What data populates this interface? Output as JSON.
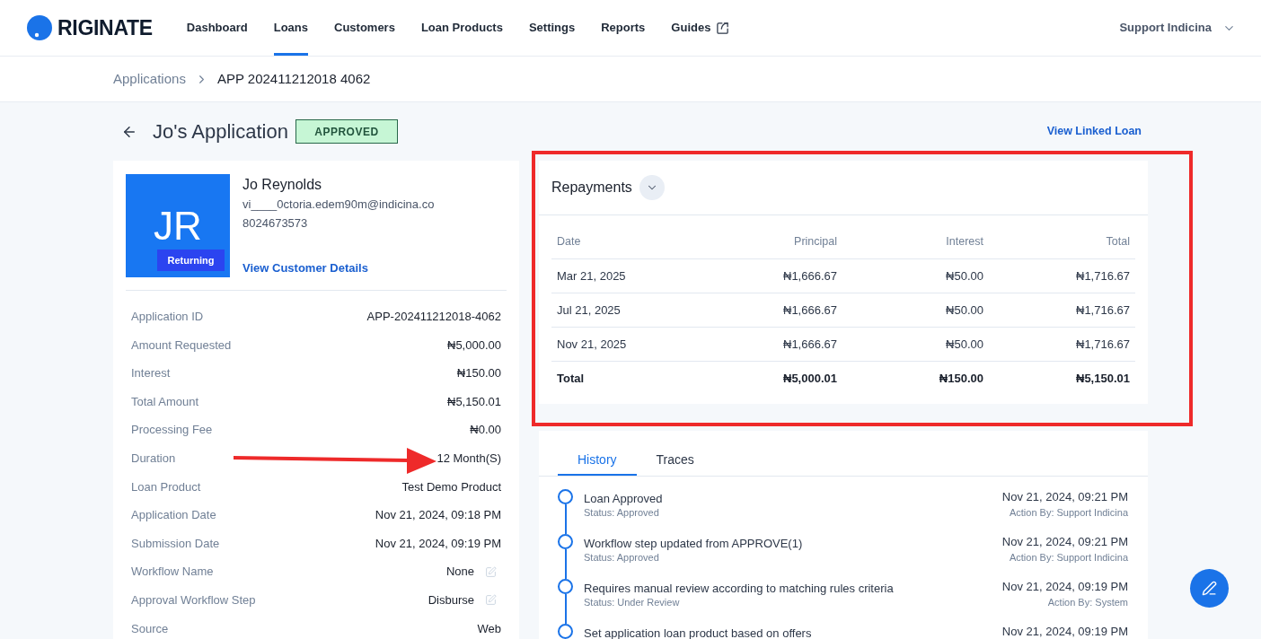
{
  "header": {
    "brand": "RIGINATE",
    "nav": [
      {
        "label": "Dashboard",
        "selected": false,
        "external": false
      },
      {
        "label": "Loans",
        "selected": true,
        "external": false
      },
      {
        "label": "Customers",
        "selected": false,
        "external": false
      },
      {
        "label": "Loan Products",
        "selected": false,
        "external": false
      },
      {
        "label": "Settings",
        "selected": false,
        "external": false
      },
      {
        "label": "Reports",
        "selected": false,
        "external": false
      },
      {
        "label": "Guides",
        "selected": false,
        "external": true
      }
    ],
    "user_menu": "Support Indicina"
  },
  "breadcrumb": [
    {
      "label": "Applications",
      "current": false
    },
    {
      "label": "APP 202411212018 4062",
      "current": true
    }
  ],
  "application": {
    "title": "Jo's Application",
    "status": "APPROVED",
    "linked_loan_link": "View Linked Loan"
  },
  "customer": {
    "initials": "JR",
    "tag": "Returning",
    "name": "Jo Reynolds",
    "email": "vi____0ctoria.edem90m@indicina.co",
    "phone": "8024673573",
    "details_link": "View Customer Details"
  },
  "details": [
    {
      "label": "Application ID",
      "value": "APP-202411212018-4062",
      "editable": false
    },
    {
      "label": "Amount Requested",
      "value": "₦5,000.00",
      "editable": false
    },
    {
      "label": "Interest",
      "value": "₦150.00",
      "editable": false
    },
    {
      "label": "Total Amount",
      "value": "₦5,150.01",
      "editable": false
    },
    {
      "label": "Processing Fee",
      "value": "₦0.00",
      "editable": false
    },
    {
      "label": "Duration",
      "value": "12 Month(S)",
      "editable": false
    },
    {
      "label": "Loan Product",
      "value": "Test Demo Product",
      "editable": false
    },
    {
      "label": "Application Date",
      "value": "Nov 21, 2024, 09:18 PM",
      "editable": false
    },
    {
      "label": "Submission Date",
      "value": "Nov 21, 2024, 09:19 PM",
      "editable": false
    },
    {
      "label": "Workflow Name",
      "value": "None",
      "editable": true
    },
    {
      "label": "Approval Workflow Step",
      "value": "Disburse",
      "editable": true
    },
    {
      "label": "Source",
      "value": "Web",
      "editable": false
    }
  ],
  "repayments": {
    "title": "Repayments",
    "columns": [
      "Date",
      "Principal",
      "Interest",
      "Total"
    ],
    "rows": [
      [
        "Mar 21, 2025",
        "₦1,666.67",
        "₦50.00",
        "₦1,716.67"
      ],
      [
        "Jul 21, 2025",
        "₦1,666.67",
        "₦50.00",
        "₦1,716.67"
      ],
      [
        "Nov 21, 2025",
        "₦1,666.67",
        "₦50.00",
        "₦1,716.67"
      ]
    ],
    "totals": [
      "Total",
      "₦5,000.01",
      "₦150.00",
      "₦5,150.01"
    ]
  },
  "activity": {
    "tabs": [
      {
        "label": "History",
        "selected": true
      },
      {
        "label": "Traces",
        "selected": false
      }
    ],
    "events": [
      {
        "title": "Loan Approved",
        "status": "Status: Approved",
        "time": "Nov 21, 2024, 09:21 PM",
        "actor": "Action By: Support Indicina"
      },
      {
        "title": "Workflow step updated from APPROVE(1)",
        "status": "Status: Approved",
        "time": "Nov 21, 2024, 09:21 PM",
        "actor": "Action By: Support Indicina"
      },
      {
        "title": "Requires manual review according to matching rules criteria",
        "status": "Status: Under Review",
        "time": "Nov 21, 2024, 09:19 PM",
        "actor": "Action By: System"
      },
      {
        "title": "Set application loan product based on offers",
        "time": "Nov 21, 2024, 09:19 PM"
      }
    ]
  }
}
